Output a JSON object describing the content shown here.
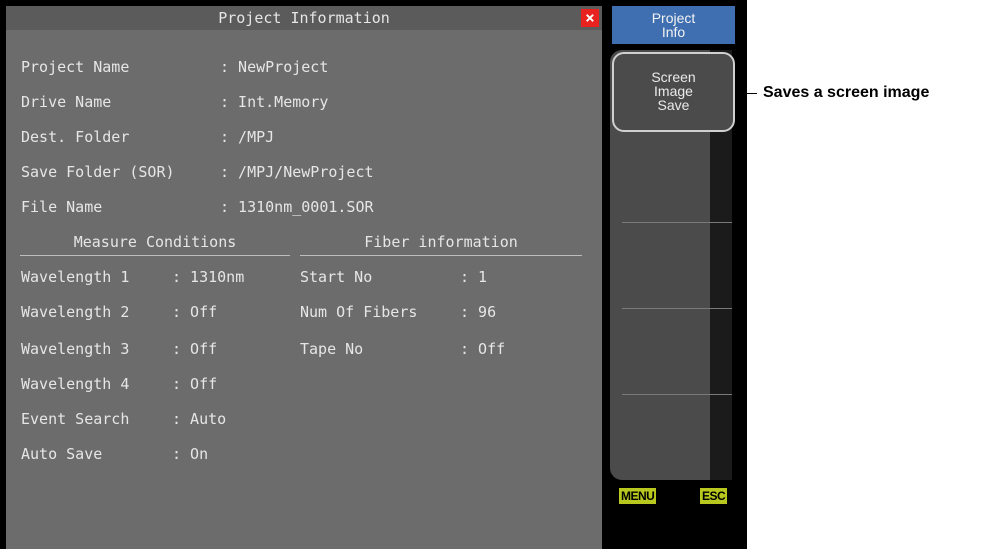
{
  "dialog": {
    "title": "Project Information",
    "close_icon": "×",
    "fields": [
      {
        "label": "Project Name",
        "value": ": NewProject"
      },
      {
        "label": "Drive Name",
        "value": ": Int.Memory"
      },
      {
        "label": "Dest. Folder",
        "value": ": /MPJ"
      },
      {
        "label": "Save Folder (SOR)",
        "value": ": /MPJ/NewProject"
      },
      {
        "label": "File Name",
        "value": ": 1310nm_0001.SOR"
      }
    ],
    "measure_conditions": {
      "header": "Measure Conditions",
      "rows": [
        {
          "label": "Wavelength 1",
          "value": ": 1310nm"
        },
        {
          "label": "Wavelength 2",
          "value": ": Off"
        },
        {
          "label": "Wavelength 3",
          "value": ": Off"
        },
        {
          "label": "Wavelength 4",
          "value": ": Off"
        },
        {
          "label": "Event Search",
          "value": ": Auto"
        },
        {
          "label": "Auto Save",
          "value": ": On"
        }
      ]
    },
    "fiber_information": {
      "header": "Fiber information",
      "rows": [
        {
          "label": "Start No",
          "value": ": 1"
        },
        {
          "label": "Num Of Fibers",
          "value": ": 96"
        },
        {
          "label": "Tape No",
          "value": ": Off"
        }
      ]
    }
  },
  "softkeys": {
    "top": [
      "Project",
      "Info"
    ],
    "screen_image_save": [
      "Screen",
      "Image",
      "Save"
    ],
    "menu": "MENU",
    "esc": "ESC"
  },
  "callout": "Saves a screen image",
  "colors": {
    "panel": "#6c6c6c",
    "title_bar": "#5b5b5b",
    "close": "#e8231f",
    "softkey_active": "#3f6fb0",
    "footer_keys": "#b8c81e"
  }
}
